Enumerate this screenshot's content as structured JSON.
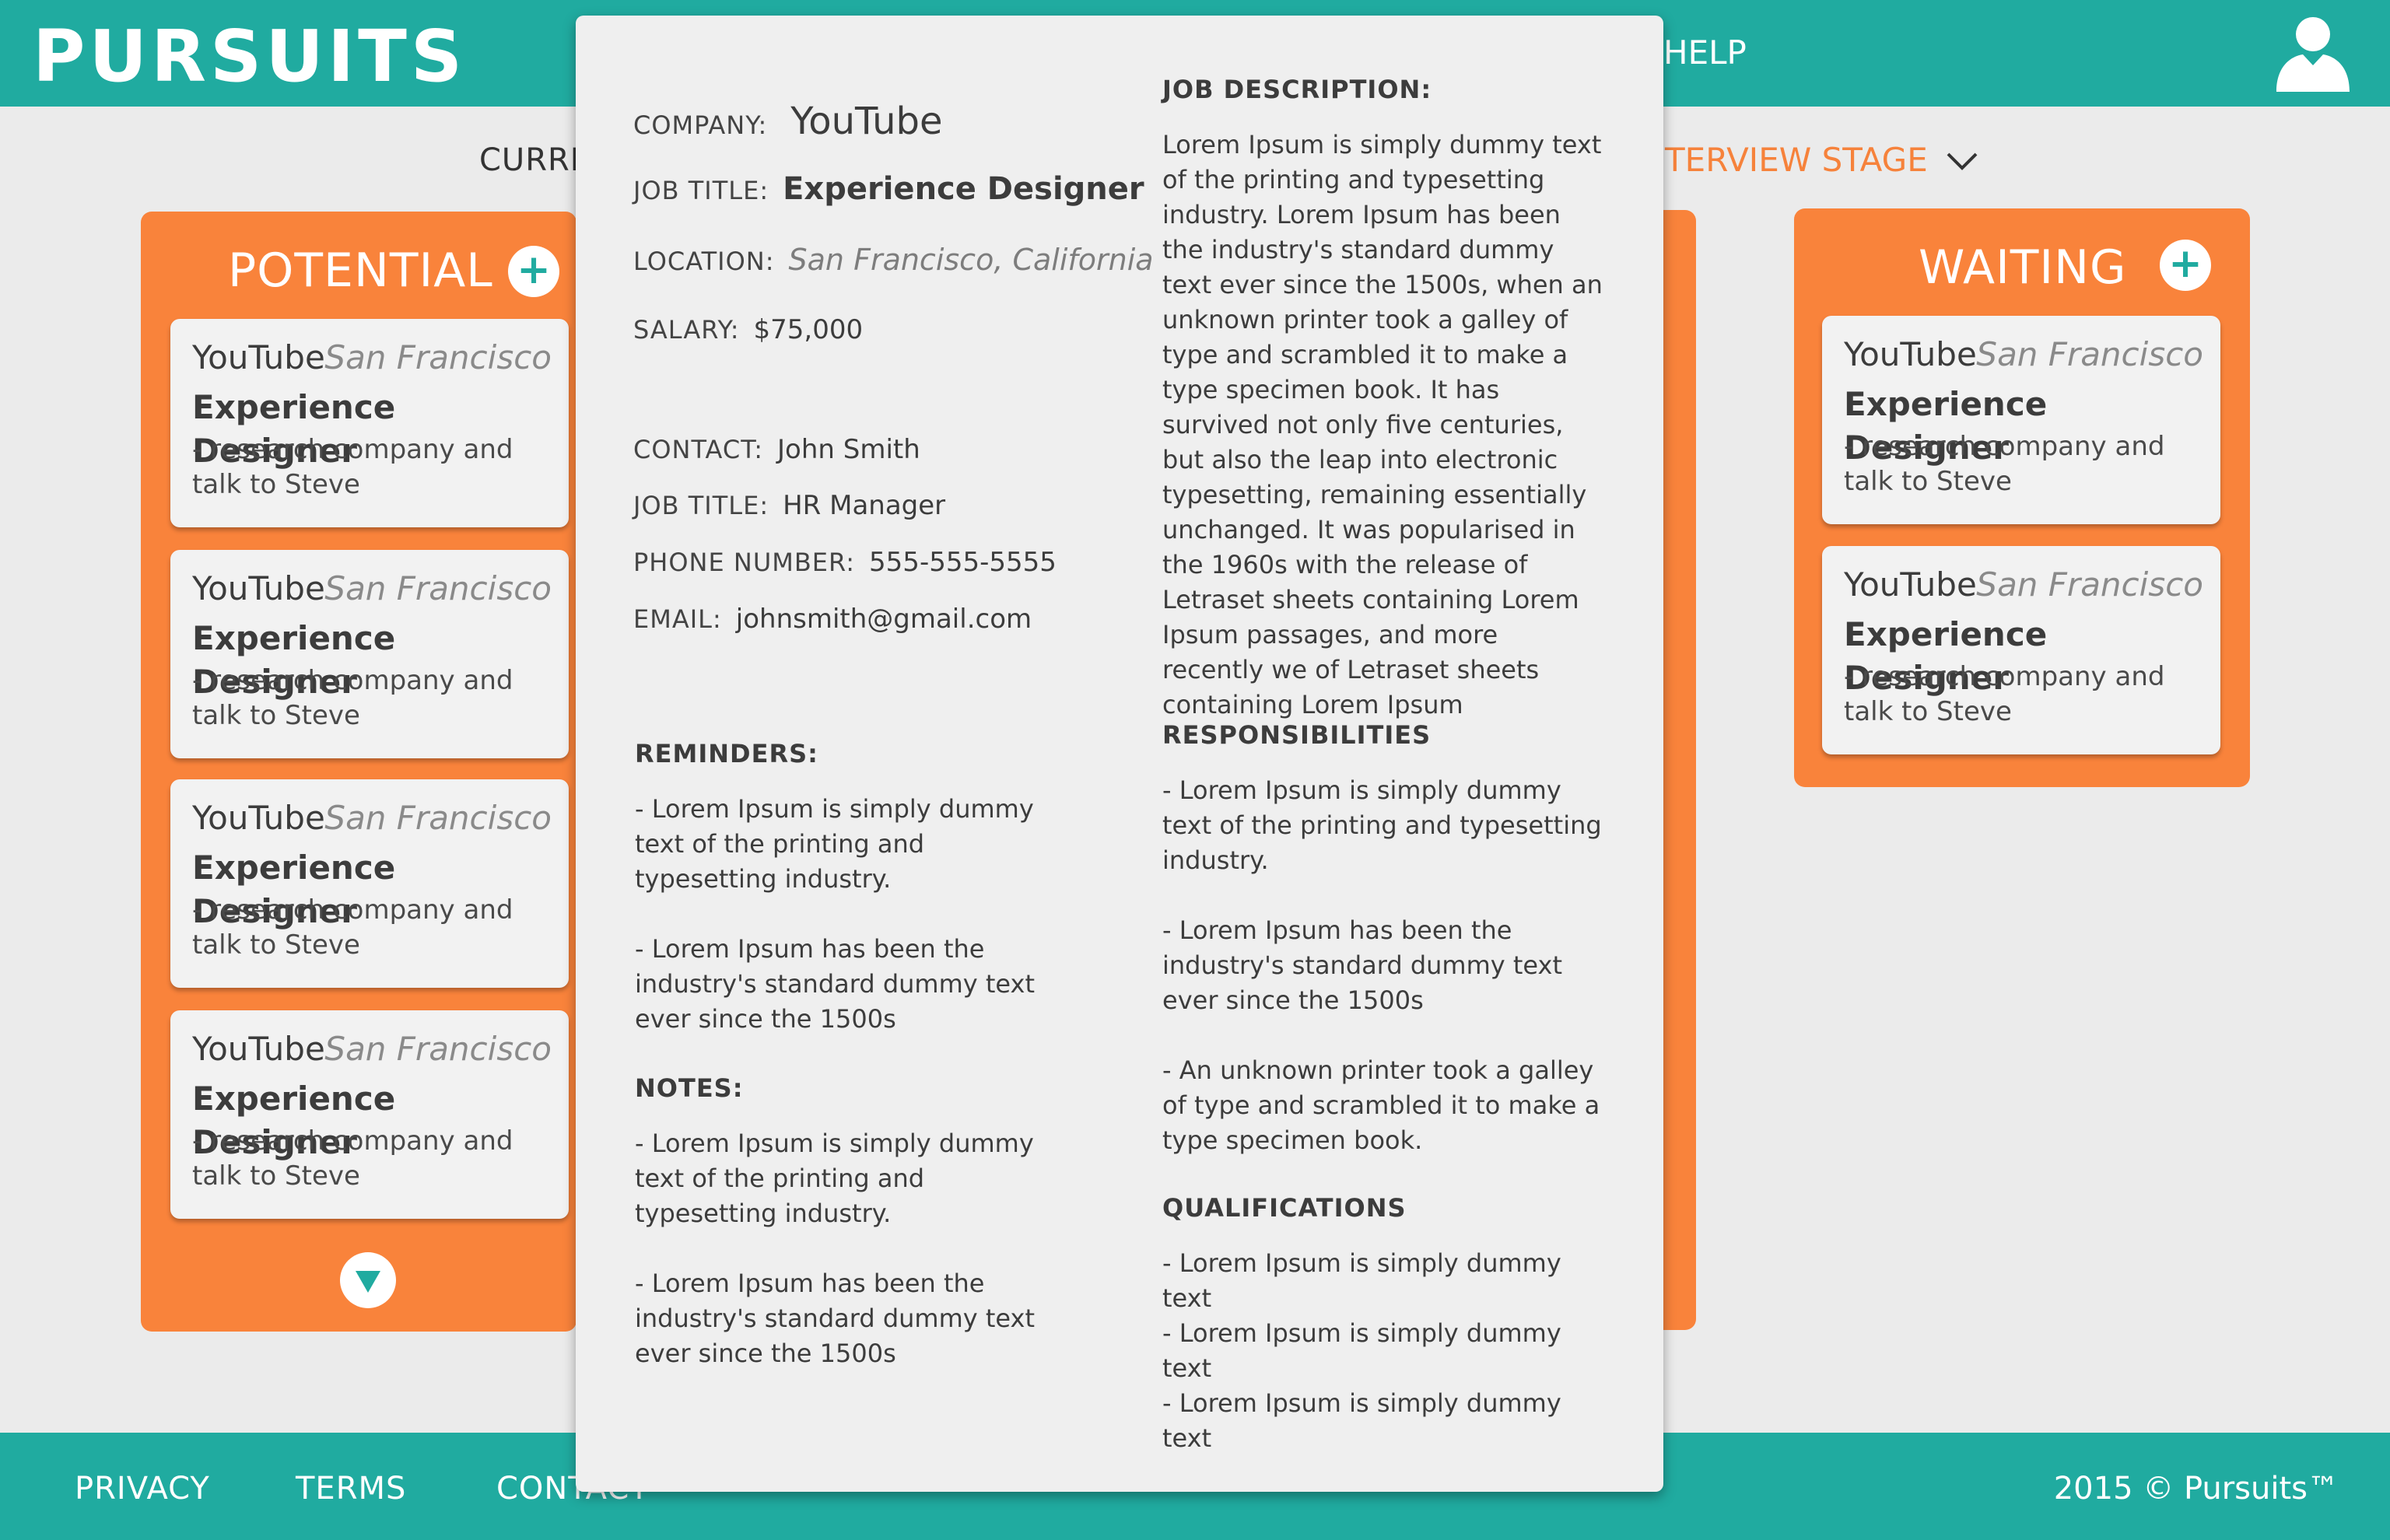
{
  "header": {
    "logo": "PURSUITS",
    "help_label": "HELP"
  },
  "subnav": {
    "current_label": "CURRE",
    "stage_label": "TERVIEW STAGE"
  },
  "columns": {
    "potential": {
      "title": "POTENTIAL",
      "add_symbol": "+",
      "cards": [
        {
          "company": "YouTube",
          "location": "San Francisco",
          "title": "Experience Designer",
          "note": "- research company and talk to Steve"
        },
        {
          "company": "YouTube",
          "location": "San Francisco",
          "title": "Experience Designer",
          "note": "- research company and talk to Steve"
        },
        {
          "company": "YouTube",
          "location": "San Francisco",
          "title": "Experience Designer",
          "note": "- research company and talk to Steve"
        },
        {
          "company": "YouTube",
          "location": "San Francisco",
          "title": "Experience Designer",
          "note": "- research company and talk to Steve"
        }
      ]
    },
    "waiting": {
      "title": "WAITING",
      "add_symbol": "+",
      "cards": [
        {
          "company": "YouTube",
          "location": "San Francisco",
          "title": "Experience Designer",
          "note": "- research company and talk to Steve"
        },
        {
          "company": "YouTube",
          "location": "San Francisco",
          "title": "Experience Designer",
          "note": "- research company and talk to Steve"
        }
      ]
    }
  },
  "modal": {
    "company_label": "COMPANY:",
    "company": "YouTube",
    "job_title_label": "JOB TITLE:",
    "job_title": "Experience Designer",
    "location_label": "LOCATION:",
    "location": "San Francisco, California",
    "salary_label": "SALARY:",
    "salary": "$75,000",
    "contact_label": "CONTACT:",
    "contact": "John Smith",
    "contact_job_title_label": "JOB TITLE:",
    "contact_job_title": "HR Manager",
    "phone_label": "PHONE NUMBER:",
    "phone": "555-555-5555",
    "email_label": "EMAIL:",
    "email": "johnsmith@gmail.com",
    "reminders_heading": "REMINDERS:",
    "reminders": [
      "- Lorem Ipsum is simply dummy text of the printing and typesetting industry.",
      "- Lorem Ipsum has been the industry's standard dummy text ever since the 1500s"
    ],
    "notes_heading": "NOTES:",
    "notes": [
      "- Lorem Ipsum is simply dummy text of the printing and typesetting industry.",
      "- Lorem Ipsum has been the industry's standard dummy text ever since the 1500s"
    ],
    "job_description_heading": "JOB DESCRIPTION:",
    "job_description": "Lorem Ipsum is simply dummy text of the printing and typesetting industry. Lorem Ipsum has been the industry's standard dummy text ever since the 1500s, when an unknown printer took a galley of type and scrambled it to make a type specimen book. It has survived not only five centuries, but also the leap into electronic typesetting, remaining essentially unchanged. It was popularised in the 1960s with the release of Letraset sheets containing Lorem Ipsum passages, and more recently we of Letraset sheets containing Lorem Ipsum",
    "responsibilities_heading": "RESPONSIBILITIES",
    "responsibilities": [
      "- Lorem Ipsum is simply dummy text of the printing and typesetting industry.",
      "- Lorem Ipsum has been the industry's standard dummy text ever since the 1500s",
      "- An unknown printer took a galley of type and scrambled it to make a type specimen book."
    ],
    "qualifications_heading": "QUALIFICATIONS",
    "qualifications": [
      "- Lorem Ipsum is simply dummy text",
      "- Lorem Ipsum is simply dummy text",
      "- Lorem Ipsum is simply dummy text"
    ]
  },
  "footer": {
    "privacy": "PRIVACY",
    "terms": "TERMS",
    "contact": "CONTACT",
    "copyright": "2015 © Pursuits™"
  },
  "colors": {
    "teal": "#20aba0",
    "orange": "#f9833b",
    "modal_bg": "#efefef"
  },
  "icons": {
    "user": "user-icon",
    "add": "plus-icon",
    "dropdown": "chevron-down-icon",
    "scroll": "triangle-down-icon"
  }
}
